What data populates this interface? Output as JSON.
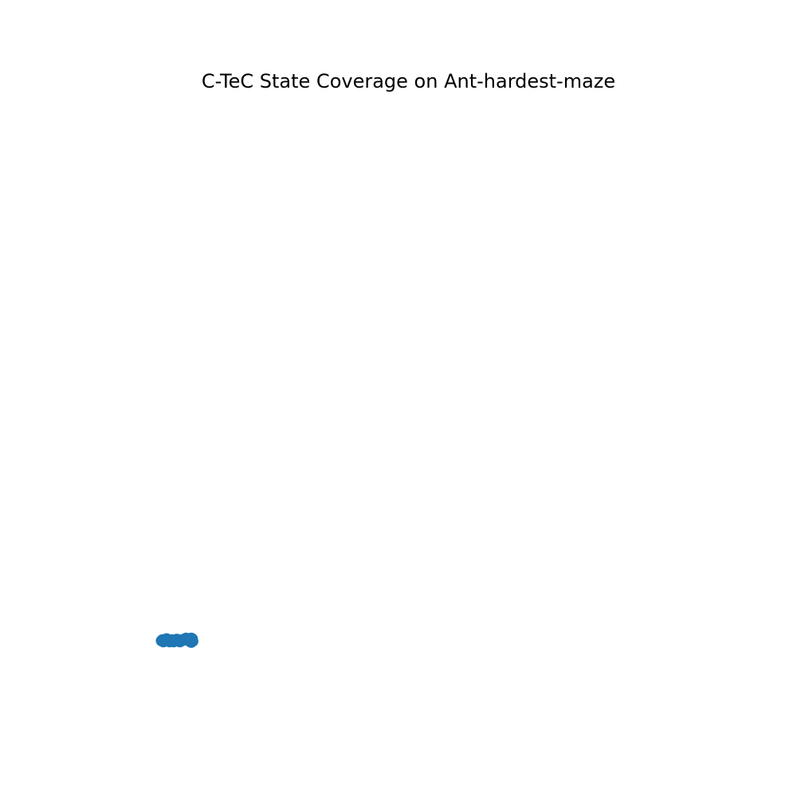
{
  "chart_data": {
    "type": "scatter",
    "title": "C-TeC State Coverage on Ant-hardest-maze",
    "xlabel": "",
    "ylabel": "",
    "axes_visible": false,
    "grid": false,
    "xlim": [
      -6,
      54
    ],
    "ylim": [
      -6,
      54
    ],
    "series": [
      {
        "color": "#1f77b4",
        "marker": "circle",
        "points": [
          [
            0.0,
            0.0
          ],
          [
            0.1,
            0.1
          ],
          [
            0.2,
            -0.1
          ],
          [
            0.3,
            0.0
          ],
          [
            0.4,
            0.1
          ],
          [
            0.5,
            0.2
          ],
          [
            0.6,
            0.1
          ],
          [
            0.7,
            0.0
          ],
          [
            0.8,
            -0.1
          ],
          [
            0.9,
            0.0
          ],
          [
            1.0,
            0.1
          ],
          [
            1.1,
            0.0
          ],
          [
            1.2,
            -0.1
          ],
          [
            1.3,
            0.0
          ],
          [
            1.4,
            0.1
          ],
          [
            1.5,
            0.15
          ],
          [
            1.6,
            0.05
          ],
          [
            1.7,
            -0.05
          ],
          [
            1.8,
            -0.1
          ],
          [
            1.9,
            0.0
          ],
          [
            2.0,
            0.1
          ],
          [
            2.1,
            0.05
          ],
          [
            2.2,
            0.1
          ],
          [
            2.3,
            0.2
          ],
          [
            2.4,
            0.25
          ],
          [
            2.5,
            0.15
          ],
          [
            2.6,
            0.1
          ],
          [
            2.7,
            0.0
          ],
          [
            2.8,
            -0.1
          ],
          [
            2.9,
            -0.15
          ],
          [
            2.95,
            0.1
          ],
          [
            3.0,
            0.2
          ],
          [
            2.9,
            0.25
          ],
          [
            3.05,
            -0.05
          ],
          [
            2.85,
            0.05
          ]
        ]
      }
    ]
  }
}
